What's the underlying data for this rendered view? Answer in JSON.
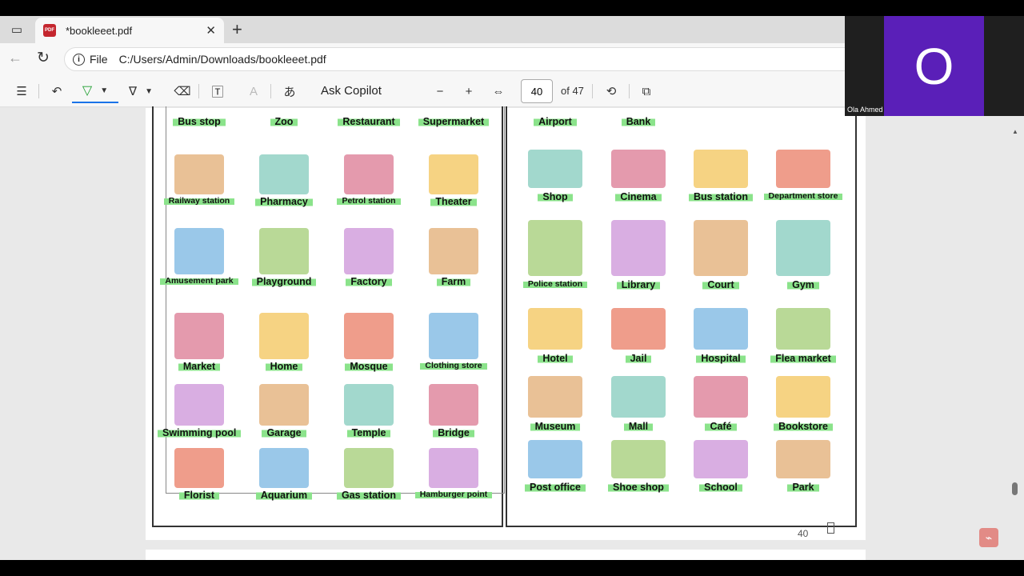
{
  "tab": {
    "title": "*bookleeet.pdf",
    "close_icon": "close-icon",
    "new_tab_icon": "plus-icon"
  },
  "address": {
    "scheme_label": "File",
    "url": "C:/Users/Admin/Downloads/bookleeet.pdf"
  },
  "toolbar": {
    "ask_copilot": "Ask Copilot",
    "page_current": "40",
    "page_total": "of 47"
  },
  "page": {
    "left": [
      {
        "label": "Bus stop"
      },
      {
        "label": "Zoo"
      },
      {
        "label": "Restaurant"
      },
      {
        "label": "Supermarket"
      },
      {
        "label": "Railway station"
      },
      {
        "label": "Pharmacy"
      },
      {
        "label": "Petrol station"
      },
      {
        "label": "Theater"
      },
      {
        "label": "Amusement park"
      },
      {
        "label": "Playground"
      },
      {
        "label": "Factory"
      },
      {
        "label": "Farm"
      },
      {
        "label": "Market"
      },
      {
        "label": "Home"
      },
      {
        "label": "Mosque"
      },
      {
        "label": "Clothing store"
      },
      {
        "label": "Swimming pool"
      },
      {
        "label": "Garage"
      },
      {
        "label": "Temple"
      },
      {
        "label": "Bridge"
      },
      {
        "label": "Florist"
      },
      {
        "label": "Aquarium"
      },
      {
        "label": "Gas station"
      },
      {
        "label": "Hamburger point"
      }
    ],
    "right": [
      {
        "label": "Airport"
      },
      {
        "label": "Bank"
      },
      {
        "label": "Shop"
      },
      {
        "label": "Cinema"
      },
      {
        "label": "Bus station"
      },
      {
        "label": "Department store"
      },
      {
        "label": "Police station"
      },
      {
        "label": "Library"
      },
      {
        "label": "Court"
      },
      {
        "label": "Gym"
      },
      {
        "label": "Hotel"
      },
      {
        "label": "Jail"
      },
      {
        "label": "Hospital"
      },
      {
        "label": "Flea market"
      },
      {
        "label": "Museum"
      },
      {
        "label": "Mall"
      },
      {
        "label": "Café"
      },
      {
        "label": "Bookstore"
      },
      {
        "label": "Post office"
      },
      {
        "label": "Shoe shop"
      },
      {
        "label": "School"
      },
      {
        "label": "Park"
      }
    ],
    "number": "40"
  },
  "video": {
    "initial": "O",
    "name": "Ola Ahmed"
  },
  "colors": {
    "highlight": "#8be38b",
    "video_tile": "#5a1fb8",
    "accent": "#1a73e8"
  }
}
